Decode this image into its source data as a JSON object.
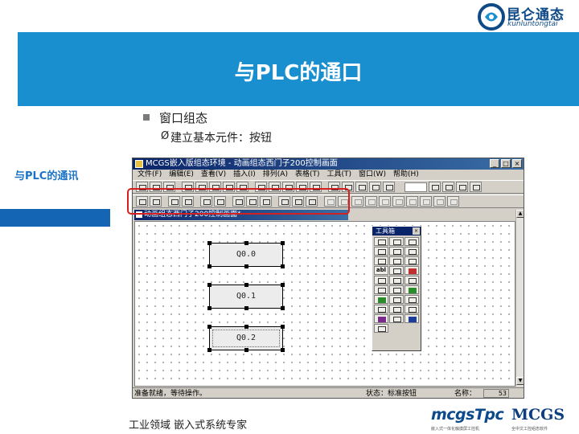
{
  "brand": {
    "logo_cn": "昆仑通态",
    "logo_en": "kunluntongtai",
    "footer_tagline": "工业领域 嵌入式系统专家",
    "logo_tpc": "mcgsTpc",
    "logo_tpc_sub": "嵌入式一体化触摸屏工控机",
    "logo_mcgs": "MCGS",
    "logo_mcgs_sub": "全中文工控组态软件"
  },
  "slide": {
    "title": "与PLC的通口",
    "side_label": "与PLC的通讯",
    "bullet": "窗口组态",
    "sub_bullet_arrow": "Ø",
    "sub_bullet": "建立基本元件：按钮"
  },
  "app_window": {
    "title": "MCGS嵌入版组态环境 - 动画组态西门子200控制画面",
    "menus": [
      "文件(F)",
      "编辑(E)",
      "查看(V)",
      "插入(I)",
      "排列(A)",
      "表格(T)",
      "工具(T)",
      "窗口(W)",
      "帮助(H)"
    ],
    "min_glyph": "_",
    "max_glyph": "□",
    "close_glyph": "×",
    "child_title": "动画组态西门子200控制画面*",
    "toolbox_title": "工具箱",
    "toolbox_close": "×",
    "toolbox_text_cell": "abl",
    "scroll_up": "▲",
    "scroll_down": "▼",
    "buttons": [
      {
        "label": "Q0.0"
      },
      {
        "label": "Q0.1"
      },
      {
        "label": "Q0.2"
      }
    ],
    "status": {
      "left": "准备就绪，等待操作。",
      "mid": "状态：标准按钮",
      "right": "名称：",
      "count": "53"
    }
  }
}
